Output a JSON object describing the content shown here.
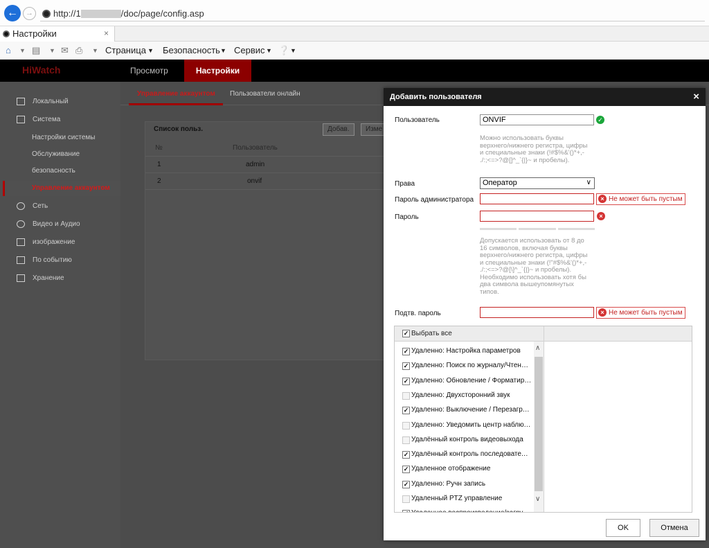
{
  "browser": {
    "url_prefix": "http://1",
    "url_suffix": "/doc/page/config.asp",
    "tab_title": "Настройки",
    "tab_close": "×",
    "menu": {
      "page": "Страница",
      "security": "Безопасность",
      "service": "Сервис"
    }
  },
  "app": {
    "logo": "HiWatch",
    "nav": {
      "preview": "Просмотр",
      "settings": "Настройки"
    },
    "sidebar": {
      "local": "Локальный",
      "system": "Система",
      "system_settings": "Настройки системы",
      "maintenance": "Обслуживание",
      "security": "безопасность",
      "account_management": "Управление аккаунтом",
      "network": "Сеть",
      "video_audio": "Видео и Аудио",
      "image": "изображение",
      "event": "По событию",
      "storage": "Хранение"
    },
    "subtabs": {
      "account": "Управление аккаунтом",
      "online_users": "Пользователи онлайн"
    },
    "user_list": {
      "title": "Список польз.",
      "add_button": "Добав.",
      "edit_button": "Изме",
      "columns": {
        "no": "№",
        "user": "Пользователь"
      },
      "rows": [
        {
          "no": "1",
          "user": "admin"
        },
        {
          "no": "2",
          "user": "onvif"
        }
      ]
    }
  },
  "dialog": {
    "title": "Добавить пользователя",
    "close": "×",
    "username_label": "Пользователь",
    "username_value": "ONVIF",
    "username_hint": "Можно использовать буквы\nверхнего/нижнего регистра, цифры\nи специальные знаки (!#$%&'()*+,-\n./:;<=>?@[]^_`{|}~ и пробелы).",
    "rights_label": "Права",
    "rights_value": "Оператор",
    "admin_password_label": "Пароль администратора",
    "password_label": "Пароль",
    "password_hint": "Допускается использовать от 8 до\n16 символов, включая буквы\nверхнего/нижнего регистра, цифры\nи специальные знаки (!\"#$%&'()*+,-\n./:;<=>?@[\\]^_`{|}~ и пробелы).\nНеобходимо использовать хотя бы\nдва символа вышеупомянутых\nтипов.",
    "confirm_label": "Подтв. пароль",
    "error_empty": "Не может быть пустым",
    "select_all": "Выбрать все",
    "permissions": [
      {
        "label": "Удаленно: Настройка параметров",
        "checked": true
      },
      {
        "label": "Удаленно: Поиск по журналу/Чтение состояния",
        "checked": true
      },
      {
        "label": "Удаленно: Обновление / Форматирование",
        "checked": true
      },
      {
        "label": "Удаленно: Двухсторонний звук",
        "checked": false
      },
      {
        "label": "Удаленно: Выключение / Перезагрузка",
        "checked": true
      },
      {
        "label": "Удаленно: Уведомить центр наблюдения",
        "checked": false
      },
      {
        "label": "Удалённый контроль видеовыхода",
        "checked": false
      },
      {
        "label": "Удалённый контроль последовательного порта",
        "checked": true
      },
      {
        "label": "Удаленное отображение",
        "checked": true
      },
      {
        "label": "Удаленно: Ручн запись",
        "checked": true
      },
      {
        "label": "Удаленный PTZ управление",
        "checked": false
      },
      {
        "label": "Удаленное воспроизведение/загрузка",
        "checked": true
      }
    ],
    "ok": "OK",
    "cancel": "Отмена"
  },
  "colors": {
    "accent": "#8c0000",
    "error": "#c52222",
    "success": "#1aa63a",
    "browser_nav": "#1e6fd9"
  }
}
